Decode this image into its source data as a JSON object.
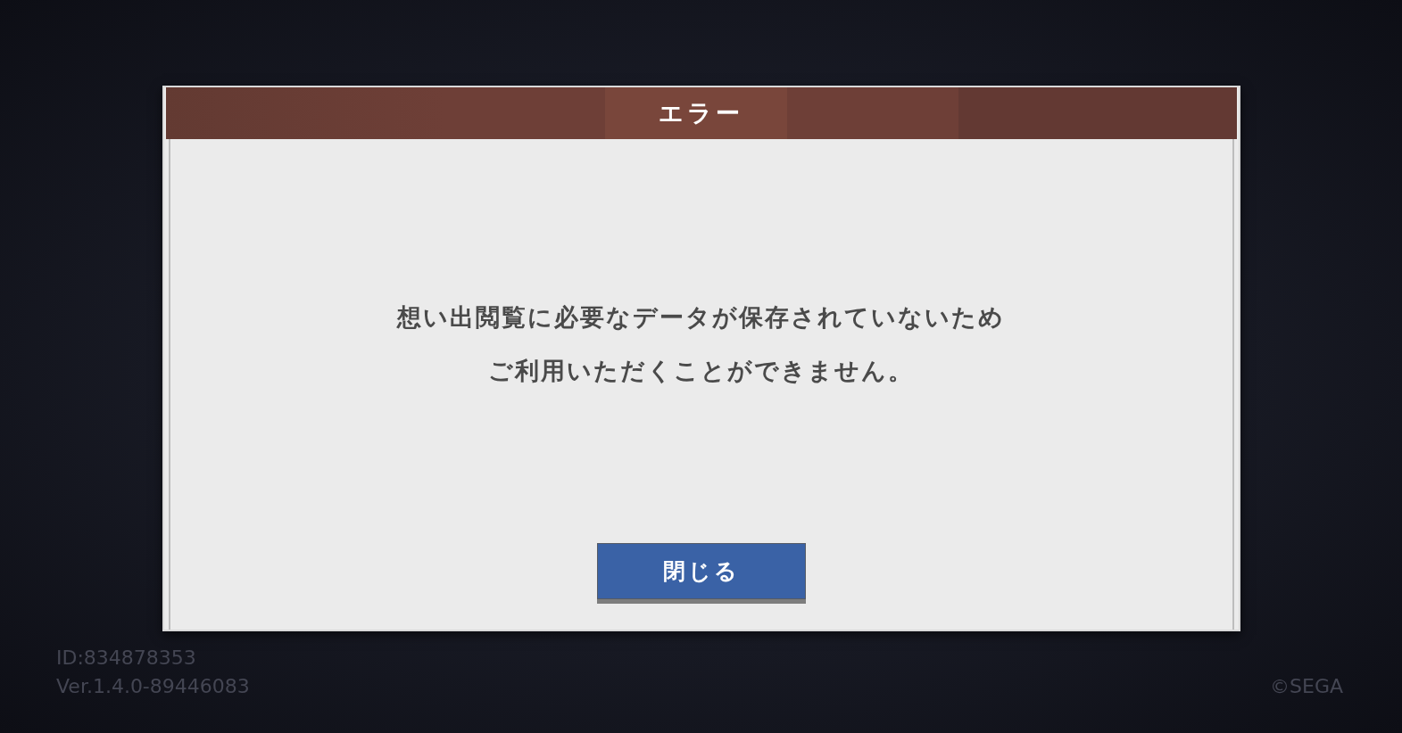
{
  "dialog": {
    "title": "エラー",
    "message": [
      "想い出閲覧に必要なデータが保存されていないため",
      "ご利用いただくことができません。"
    ],
    "buttons": [
      "閉じる"
    ]
  },
  "footer": {
    "id": "ID:834878353",
    "version": "Ver.1.4.0-89446083",
    "copyright": "©SEGA"
  }
}
